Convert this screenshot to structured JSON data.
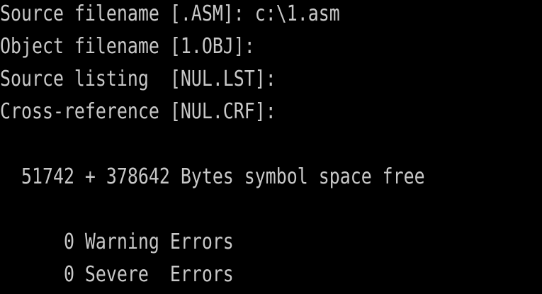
{
  "console": {
    "prompts": [
      {
        "text": "Source filename [.ASM]: c:\\1.asm"
      },
      {
        "text": "Object filename [1.OBJ]:"
      },
      {
        "text": "Source listing  [NUL.LST]:"
      },
      {
        "text": "Cross-reference [NUL.CRF]:"
      }
    ],
    "symbol_space": "  51742 + 378642 Bytes symbol space free",
    "warning_errors": "      0 Warning Errors",
    "severe_errors": "      0 Severe  Errors"
  },
  "colors": {
    "background": "#000000",
    "text": "#c8c8c8"
  }
}
